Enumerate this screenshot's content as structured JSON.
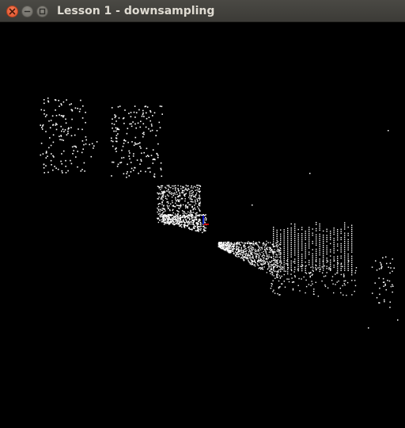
{
  "window": {
    "title": "Lesson 1 - downsampling"
  },
  "icons": {
    "close": "close-icon",
    "minimize": "minimize-icon",
    "maximize": "maximize-icon"
  },
  "colors": {
    "titlebar": "#3c3b37",
    "close_button": "#e9562f",
    "background": "#000000",
    "points": "#ffffff",
    "axis_x": "#ff0000",
    "axis_y": "#00ff00",
    "axis_z": "#0000ff"
  }
}
